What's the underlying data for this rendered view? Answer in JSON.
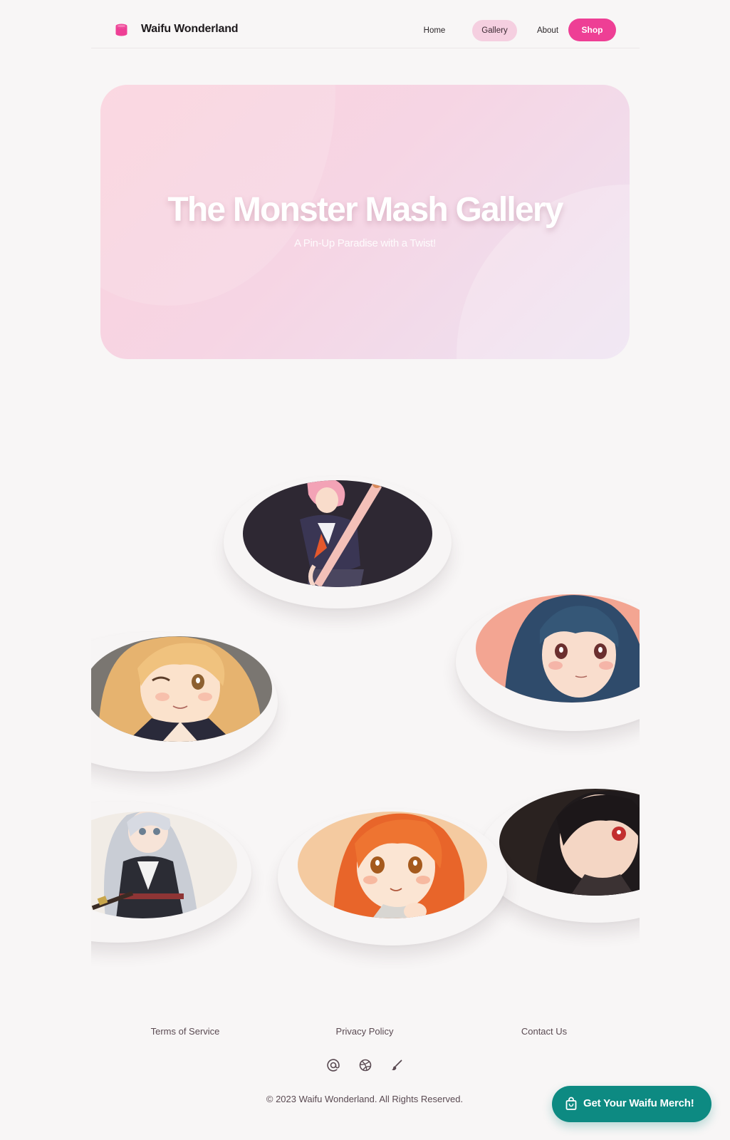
{
  "header": {
    "brand": "Waifu Wonderland",
    "nav": {
      "home": "Home",
      "gallery": "Gallery",
      "about": "About",
      "shop": "Shop"
    }
  },
  "hero": {
    "title": "The Monster Mash Gallery",
    "subtitle": "A Pin-Up Paradise with a Twist!"
  },
  "gallery": {
    "images": [
      "pink-haired girl with staff",
      "blue-haired girl",
      "blonde winking girl",
      "black-haired red-eyed girl",
      "silver-haired girl in kimono",
      "orange-haired girl"
    ]
  },
  "footer": {
    "links": {
      "terms": "Terms of Service",
      "privacy": "Privacy Policy",
      "contact": "Contact Us"
    },
    "social_icons": [
      "at-sign-icon",
      "dribbble-icon",
      "brush-icon"
    ],
    "copyright": "© 2023 Waifu Wonderland. All Rights Reserved."
  },
  "cta": {
    "label": "Get Your Waifu Merch!"
  },
  "colors": {
    "accent_pink": "#ee3f95",
    "gallery_pill": "#f5cfe0",
    "cta_teal": "#0d8a82",
    "background": "#f8f6f6"
  }
}
